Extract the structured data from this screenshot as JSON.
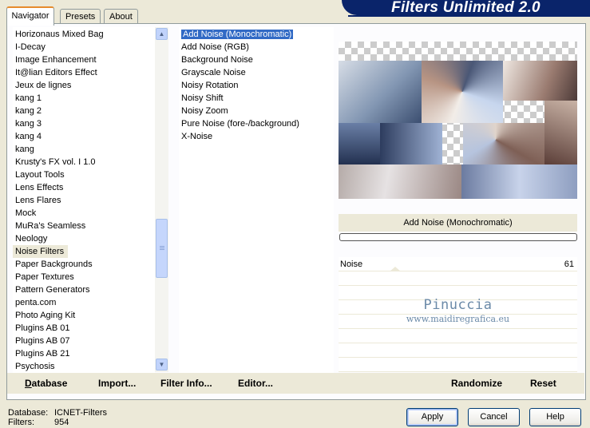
{
  "banner": {
    "title": "Filters Unlimited 2.0"
  },
  "tabs": [
    {
      "label": "Navigator"
    },
    {
      "label": "Presets"
    },
    {
      "label": "About"
    }
  ],
  "categories": [
    "Horizonaus Mixed Bag",
    "I-Decay",
    "Image Enhancement",
    "It@lian Editors Effect",
    "Jeux de lignes",
    "kang 1",
    "kang 2",
    "kang 3",
    "kang 4",
    "kang",
    "Krusty's FX vol. I 1.0",
    "Layout Tools",
    "Lens Effects",
    "Lens Flares",
    "Mock",
    "MuRa's Seamless",
    "Neology",
    "Noise Filters",
    "Paper Backgrounds",
    "Paper Textures",
    "Pattern Generators",
    "penta.com",
    "Photo Aging Kit",
    "Plugins AB 01",
    "Plugins AB 07",
    "Plugins AB 21",
    "Psychosis"
  ],
  "selected_category": "Noise Filters",
  "filters": [
    "Add Noise (Monochromatic)",
    "Add Noise (RGB)",
    "Background Noise",
    "Grayscale Noise",
    "Noisy Rotation",
    "Noisy Shift",
    "Noisy Zoom",
    "Pure Noise (fore-/background)",
    "X-Noise"
  ],
  "selected_filter": "Add Noise (Monochromatic)",
  "preview": {
    "filter_name": "Add Noise (Monochromatic)",
    "progress": 0
  },
  "parameters": [
    {
      "label": "Noise",
      "value": "61"
    }
  ],
  "watermark": {
    "name": "Pinuccia",
    "url": "www.maidiregrafica.eu"
  },
  "toolbar": {
    "database_label": "Database",
    "database_key": "D",
    "import_label": "Import...",
    "import_key": "I",
    "filterinfo_label": "Filter Info...",
    "filterinfo_key": "I",
    "editor_label": "Editor...",
    "editor_key": "E",
    "randomize_label": "Randomize",
    "reset_label": "Reset"
  },
  "status": {
    "database_key": "Database:",
    "database_value": "ICNET-Filters",
    "filters_key": "Filters:",
    "filters_value": "954"
  },
  "buttons": {
    "apply": "Apply",
    "cancel": "Cancel",
    "help": "Help"
  }
}
